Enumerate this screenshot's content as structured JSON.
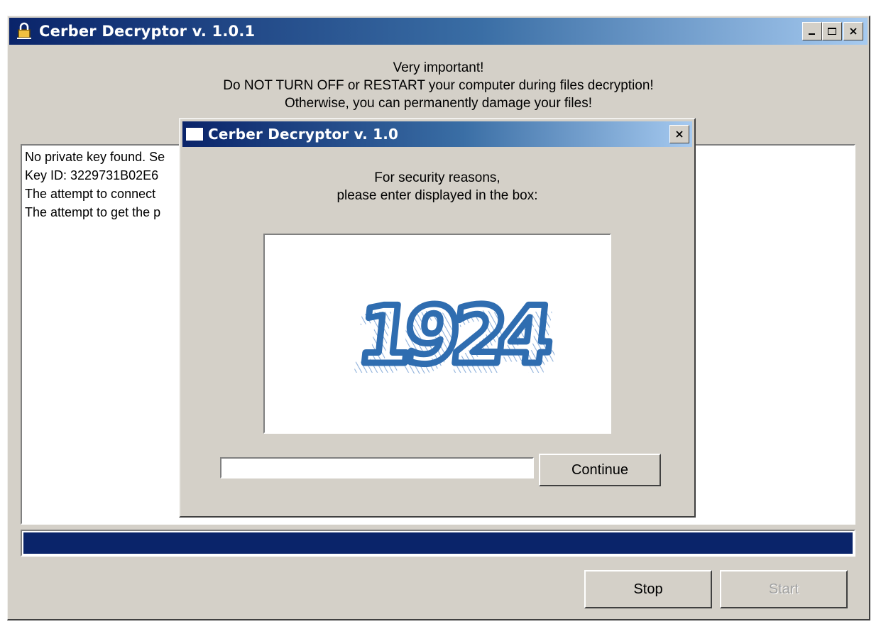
{
  "main": {
    "title": "Cerber Decryptor v. 1.0.1",
    "warning": [
      "Very important!",
      "Do NOT TURN OFF or RESTART your computer during files decryption!",
      "Otherwise, you can permanently damage your files!"
    ],
    "log_lines": [
      "No private key found. Se",
      "Key ID: 3229731B02E6",
      "The attempt to connect",
      "The attempt to get the p"
    ],
    "progress": 1.0,
    "stop_label": "Stop",
    "start_label": "Start"
  },
  "dialog": {
    "title": "Cerber Decryptor v. 1.0",
    "prompt": [
      "For security reasons,",
      "please enter displayed in the box:"
    ],
    "captcha_text": "1924",
    "captcha_color": "#2f6db0",
    "input_value": "",
    "continue_label": "Continue"
  },
  "colors": {
    "window_bg": "#d4d0c8",
    "title_start": "#0a246a",
    "title_end": "#a6caf0",
    "progress_fill": "#0a246a"
  }
}
